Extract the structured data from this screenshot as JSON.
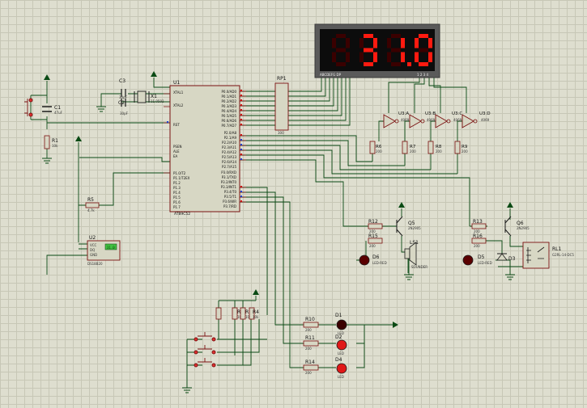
{
  "display": {
    "digits": [
      "",
      "3",
      "1",
      "0"
    ],
    "pin_label_left": "ABCDEFG  DP",
    "pin_label_right": "1 2 3 4",
    "segment_color": "#ff1a10"
  },
  "mcu": {
    "ref": "U1",
    "part": "AT89C52",
    "left_pins": [
      "XTAL1",
      "XTAL2",
      "RST",
      "PSEN",
      "ALE",
      "EA",
      "P1.0/T2",
      "P1.1/T2EX",
      "P1.2",
      "P1.3",
      "P1.4",
      "P1.5",
      "P1.6",
      "P1.7"
    ],
    "right_pins": [
      "P0.0/AD0",
      "P0.1/AD1",
      "P0.2/AD2",
      "P0.3/AD3",
      "P0.4/AD4",
      "P0.5/AD5",
      "P0.6/AD6",
      "P0.7/AD7",
      "P2.0/A8",
      "P2.1/A9",
      "P2.2/A10",
      "P2.3/A11",
      "P2.4/A12",
      "P2.5/A13",
      "P2.6/A14",
      "P2.7/A15",
      "P3.0/RXD",
      "P3.1/TXD",
      "P3.2/INT0",
      "P3.3/INT1",
      "P3.4/T0",
      "P3.5/T1",
      "P3.6/WR",
      "P3.7/RD"
    ]
  },
  "parts": {
    "C1": {
      "ref": "C1",
      "value": "47uF"
    },
    "C2": {
      "ref": "C2",
      "value": "30pF"
    },
    "C3": {
      "ref": "C3",
      "value": "30pF"
    },
    "X1": {
      "ref": "X1",
      "value": "11.0592"
    },
    "R1": {
      "ref": "R1",
      "value": "10k"
    },
    "R5": {
      "ref": "R5",
      "value": "4.7k"
    },
    "RP1": {
      "ref": "RP1",
      "value": "300"
    },
    "U2": {
      "ref": "U2",
      "pins": [
        "VCC",
        "DQ",
        "GND"
      ],
      "part": "DS18B20"
    },
    "U3A": {
      "ref": "U3:A",
      "part": "4069"
    },
    "U3B": {
      "ref": "U3:B",
      "part": "4069"
    },
    "U3C": {
      "ref": "U3:C",
      "part": "4069"
    },
    "U3D": {
      "ref": "U3:D",
      "part": "4069"
    },
    "R6": {
      "ref": "R6",
      "value": "200"
    },
    "R7": {
      "ref": "R7",
      "value": "200"
    },
    "R8": {
      "ref": "R8",
      "value": "200"
    },
    "R9": {
      "ref": "R9",
      "value": "200"
    },
    "R12": {
      "ref": "R12",
      "value": "200"
    },
    "R15": {
      "ref": "R15",
      "value": "200"
    },
    "Q5": {
      "ref": "Q5",
      "value": "2N2905"
    },
    "LS1": {
      "ref": "LS1",
      "value": "SOUNDER"
    },
    "D6": {
      "ref": "D6",
      "value": "LED-RED"
    },
    "R13": {
      "ref": "R13",
      "value": "200"
    },
    "R16": {
      "ref": "R16",
      "value": "200"
    },
    "Q6": {
      "ref": "Q6",
      "value": "2N2905"
    },
    "D5": {
      "ref": "D5",
      "value": "LED-RED"
    },
    "D3": {
      "ref": "D3"
    },
    "RL1": {
      "ref": "RL1",
      "value": "G2RL-14-DC5"
    },
    "R2": {
      "ref": "R2",
      "value": "10k"
    },
    "R3": {
      "ref": "R3",
      "value": "10k"
    },
    "R4": {
      "ref": "R4",
      "value": "10k"
    },
    "R10": {
      "ref": "R10",
      "value": "200"
    },
    "R11": {
      "ref": "R11",
      "value": "200"
    },
    "R14": {
      "ref": "R14",
      "value": "200"
    },
    "D1": {
      "ref": "D1",
      "value": "LED"
    },
    "D2": {
      "ref": "D2",
      "value": "LED"
    },
    "D4": {
      "ref": "D4",
      "value": "LED"
    }
  }
}
